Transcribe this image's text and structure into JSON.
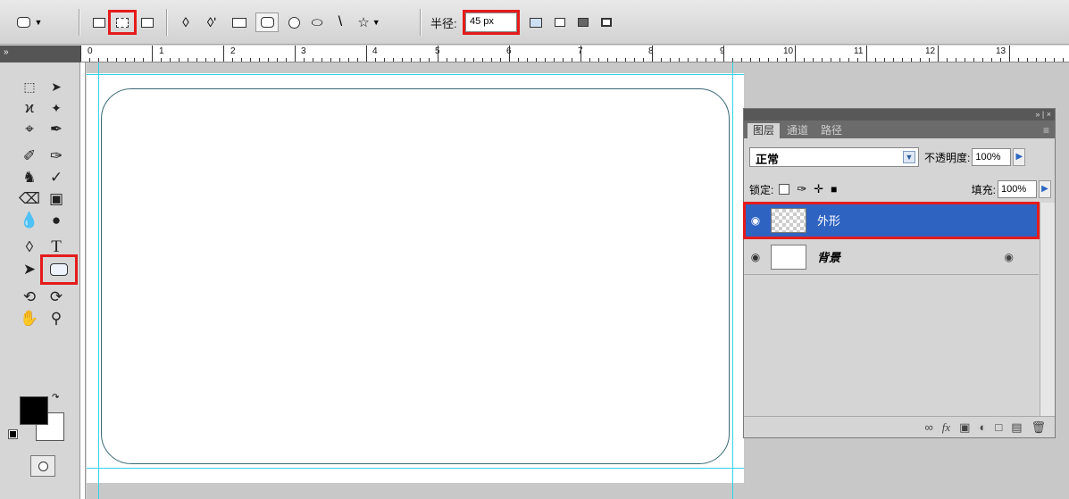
{
  "options_bar": {
    "radius_label": "半径:",
    "radius_value": "45 px"
  },
  "ruler": {
    "corner_label": "»",
    "numbers": [
      "0",
      "1",
      "2",
      "3",
      "4",
      "5",
      "6",
      "7",
      "8",
      "9",
      "10",
      "11",
      "12",
      "13"
    ]
  },
  "layers_panel": {
    "panel_controls": "» | ×",
    "tabs": [
      "图层",
      "通道",
      "路径"
    ],
    "menu_icon": "≡",
    "blend_mode": "正常",
    "opacity_label": "不透明度:",
    "opacity_value": "100%",
    "lock_label": "锁定:",
    "fill_label": "填充:",
    "fill_value": "100%",
    "layers": [
      {
        "name": "外形"
      },
      {
        "name": "背景"
      }
    ]
  },
  "colors": {
    "highlight_red": "#e51b1b",
    "selected_layer": "#2f63c2",
    "guide_cyan": "#2fd3e8"
  }
}
